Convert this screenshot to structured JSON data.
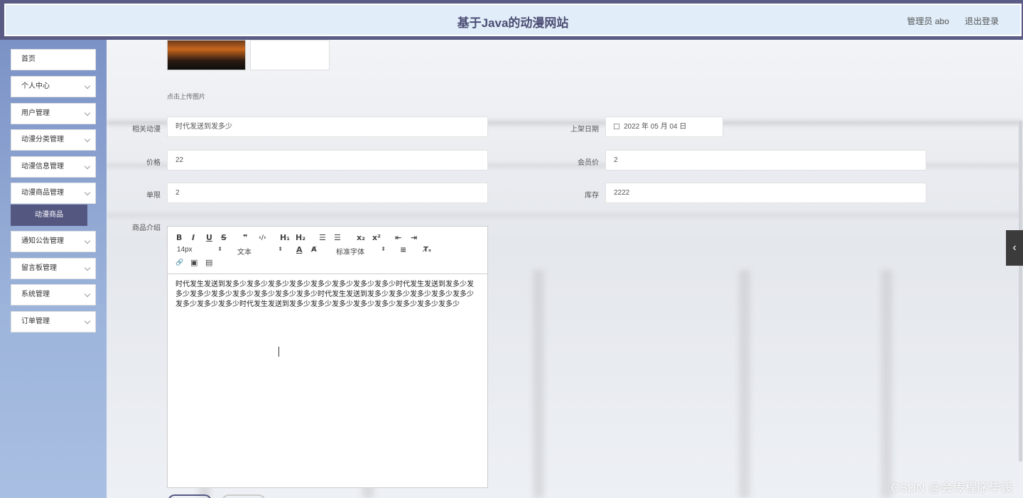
{
  "header": {
    "title": "基于Java的动漫网站",
    "user": "管理员 abo",
    "logout": "退出登录"
  },
  "sidebar": {
    "items": [
      {
        "label": "首页",
        "has_arrow": false
      },
      {
        "label": "个人中心",
        "has_arrow": true
      },
      {
        "label": "用户管理",
        "has_arrow": true
      },
      {
        "label": "动漫分类管理",
        "has_arrow": true
      },
      {
        "label": "动漫信息管理",
        "has_arrow": true
      },
      {
        "label": "动漫商品管理",
        "has_arrow": true
      },
      {
        "label": "通知公告管理",
        "has_arrow": true
      },
      {
        "label": "留言板管理",
        "has_arrow": true
      },
      {
        "label": "系统管理",
        "has_arrow": true
      },
      {
        "label": "订单管理",
        "has_arrow": true
      }
    ],
    "active_sub": "动漫商品"
  },
  "form": {
    "upload_tip": "点击上传图片",
    "related_anime": {
      "label": "相关动漫",
      "value": "时代发送到发多少"
    },
    "list_date": {
      "label": "上架日期",
      "value": "2022 年 05 月 04 日"
    },
    "price": {
      "label": "价格",
      "value": "22"
    },
    "member_price": {
      "label": "会员价",
      "value": "2"
    },
    "limit": {
      "label": "单限",
      "value": "2"
    },
    "stock": {
      "label": "库存",
      "value": "2222"
    },
    "description": {
      "label": "商品介绍"
    }
  },
  "editor": {
    "font_size": "14px",
    "block_type": "文本",
    "font_family": "标准字体",
    "buttons": {
      "bold": "B",
      "italic": "I",
      "underline": "U",
      "strike": "S",
      "quote": "❞",
      "code": "‹/›",
      "h1": "H₁",
      "h2": "H₂",
      "ol": "☰",
      "ul": "☰",
      "sub": "x₂",
      "sup": "x²",
      "outdent": "⇤",
      "indent": "⇥",
      "color": "A",
      "bg": "A̸",
      "align": "≡",
      "clean": "T̸ₓ",
      "link": "🔗",
      "image": "▣",
      "video": "▤"
    },
    "content": "时代发生发送到发多少发多少发多少发多少发多少发多少发多少发多少时代发生发送到发多少发多少发多少发多少发多少发多少发多少发多少时代发生发送到发多少发多少发多少发多少发多少发多少发多少发多少时代发生发送到发多少发多少发多少发多少发多少发多少发多少发多少"
  },
  "side_tab": "‹",
  "watermark": "CSDN @会传程序毕设"
}
